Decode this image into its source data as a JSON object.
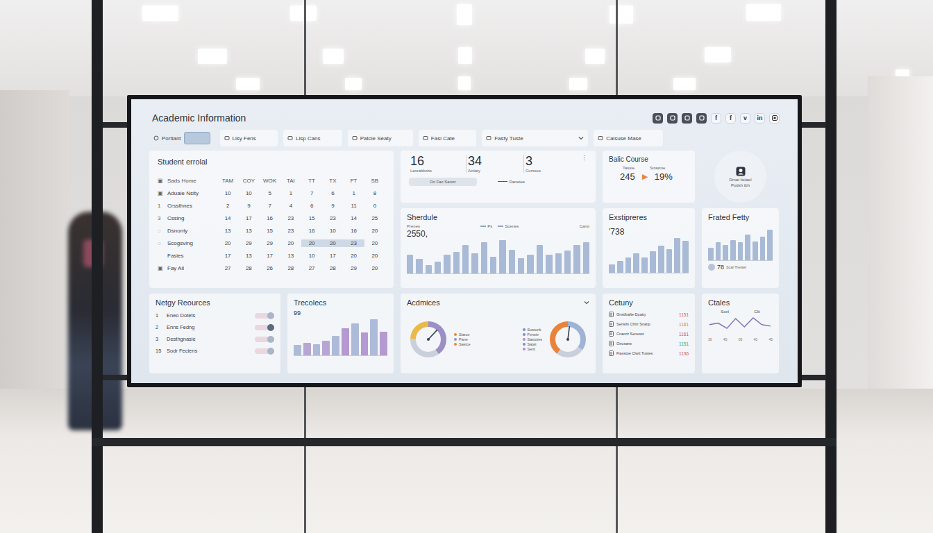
{
  "title": "Academic Information",
  "social": [
    "f",
    "f",
    "v",
    "in"
  ],
  "filters": [
    {
      "label": "Portiant",
      "kind": "radio",
      "selected": true
    },
    {
      "label": "Lisy Fens",
      "kind": "tab",
      "selected": false
    },
    {
      "label": "Lisp Cans",
      "kind": "tab",
      "selected": false
    },
    {
      "label": "Patcie Seaty",
      "kind": "tab",
      "selected": false
    },
    {
      "label": "Fasi Cate",
      "kind": "tab",
      "selected": false
    },
    {
      "label": "Fasty Tuste",
      "kind": "dropdown",
      "selected": false
    },
    {
      "label": "Calsuse Mase",
      "kind": "tab",
      "selected": false
    }
  ],
  "profile": {
    "name": "Dmat Itelael",
    "sub": "Podsh tbh"
  },
  "enrollment": {
    "title": "Student errolal",
    "header_mark": "▣",
    "header_label": "Sads Home",
    "columns": [
      "TAM",
      "COY",
      "WOK",
      "TAI",
      "TT",
      "TX",
      "FT",
      "SB"
    ],
    "rows": [
      {
        "mark": "▣",
        "label": "Aduaie Nsity",
        "cells": [
          "10",
          "10",
          "5",
          "1",
          "7",
          "6",
          "1",
          "8"
        ],
        "selected": [
          false,
          false,
          false,
          false,
          false,
          false,
          false,
          false
        ]
      },
      {
        "mark": "1",
        "label": "Crssthnes",
        "cells": [
          "2",
          "9",
          "7",
          "4",
          "6",
          "9",
          "11",
          "0"
        ],
        "selected": [
          false,
          false,
          false,
          false,
          false,
          false,
          false,
          false
        ]
      },
      {
        "mark": "3",
        "label": "Cssing",
        "cells": [
          "14",
          "17",
          "16",
          "23",
          "15",
          "23",
          "14",
          "25"
        ],
        "selected": [
          false,
          false,
          false,
          false,
          false,
          false,
          false,
          false
        ]
      },
      {
        "mark": "◌",
        "label": "Dsnonty",
        "cells": [
          "13",
          "13",
          "15",
          "23",
          "16",
          "10",
          "16",
          "20"
        ],
        "selected": [
          false,
          false,
          false,
          false,
          false,
          false,
          false,
          false
        ]
      },
      {
        "mark": "◌",
        "label": "Scogsving",
        "cells": [
          "20",
          "29",
          "29",
          "20",
          "20",
          "20",
          "23",
          "20"
        ],
        "selected": [
          false,
          false,
          false,
          false,
          true,
          true,
          true,
          false
        ]
      },
      {
        "mark": "",
        "label": "Fasies",
        "cells": [
          "17",
          "13",
          "17",
          "13",
          "10",
          "17",
          "20",
          "20"
        ],
        "selected": [
          false,
          false,
          false,
          false,
          false,
          false,
          false,
          false
        ]
      },
      {
        "mark": "▣",
        "label": "Fay Ail",
        "cells": [
          "27",
          "28",
          "26",
          "28",
          "27",
          "28",
          "29",
          "20"
        ],
        "selected": [
          false,
          false,
          false,
          false,
          false,
          false,
          false,
          false
        ]
      }
    ]
  },
  "stats": {
    "items": [
      {
        "value": "16",
        "label": "Lasrabbsbs"
      },
      {
        "value": "34",
        "label": "Actiaty"
      },
      {
        "value": "3",
        "label": "Cursses"
      }
    ],
    "more": "⋮",
    "pill": "On Fac Sarotr",
    "note": "Danetes"
  },
  "course": {
    "title": "Balic Course",
    "labels": [
      "Tassie",
      "Strastne"
    ],
    "value": "245",
    "arrow": "▶",
    "percent": "19%"
  },
  "schedule": {
    "title": "Sherdule",
    "left_label": "Prenes",
    "legend": [
      "Ps",
      "Scenes"
    ],
    "right_label": "Carst",
    "value": "2550,",
    "values": [
      40,
      30,
      18,
      25,
      40,
      45,
      60,
      42,
      65,
      35,
      70,
      50,
      32,
      40,
      60,
      40,
      42,
      48,
      60,
      66
    ]
  },
  "experiences": {
    "title": "Exstipreres",
    "value": "'738",
    "values": [
      20,
      28,
      35,
      45,
      35,
      50,
      62,
      55,
      80,
      74
    ]
  },
  "frated": {
    "title": "Frated Fetty",
    "values": [
      30,
      42,
      36,
      48,
      42,
      60,
      45,
      55,
      72
    ],
    "footer_value": "78",
    "footer_label": "Scal Trestel"
  },
  "resources": {
    "title": "Netgy Reources",
    "items": [
      {
        "num": "1",
        "label": "Eneo Dotets",
        "on": false
      },
      {
        "num": "2",
        "label": "Enns Fedng",
        "on": true
      },
      {
        "num": "3",
        "label": "Desthgnasie",
        "on": false
      },
      {
        "num": "15",
        "label": "Sodr Feciens",
        "on": false
      }
    ]
  },
  "trec": {
    "title": "Trecolecs",
    "value": "99",
    "bars": [
      {
        "value": 20,
        "color": "#aebbd8"
      },
      {
        "value": 24,
        "color": "#b7a6d3"
      },
      {
        "value": 22,
        "color": "#aebbd8"
      },
      {
        "value": 28,
        "color": "#b7a6d3"
      },
      {
        "value": 38,
        "color": "#aebbd8"
      },
      {
        "value": 52,
        "color": "#b49ad0"
      },
      {
        "value": 62,
        "color": "#aebbd8"
      },
      {
        "value": 44,
        "color": "#b49ad0"
      },
      {
        "value": 70,
        "color": "#aebbd8"
      },
      {
        "value": 46,
        "color": "#b49ad0"
      }
    ]
  },
  "academics": {
    "title": "Acdmices",
    "gauges": [
      {
        "kind": "legend-right",
        "level": 0.12,
        "segments": [
          {
            "value": 40,
            "color": "#9b8fc4"
          },
          {
            "value": 35,
            "color": "#c9d0dc"
          },
          {
            "value": 25,
            "color": "#e9b949"
          }
        ],
        "legend": [
          {
            "label": "Siarce",
            "color": "#e58a3a"
          },
          {
            "label": "Pane",
            "color": "#9b8fc4"
          },
          {
            "label": "Sasice",
            "color": "#e58a3a"
          }
        ]
      },
      {
        "kind": "legend-left",
        "level": 0.02,
        "segments": [
          {
            "value": 35,
            "color": "#9fb3d6"
          },
          {
            "value": 25,
            "color": "#c9d0dc"
          },
          {
            "value": 40,
            "color": "#e8833a"
          }
        ],
        "legend": [
          {
            "label": "Sustunk",
            "color": "#7b8bc6"
          },
          {
            "label": "Fensie",
            "color": "#7b8bc6"
          },
          {
            "label": "Sastotes",
            "color": "#b98ad0"
          },
          {
            "label": "Satat",
            "color": "#7b8bc6"
          },
          {
            "label": "Sent",
            "color": "#b98ad0"
          }
        ]
      }
    ]
  },
  "century": {
    "title": "Cetuny",
    "rows": [
      {
        "label": "Gnstlbafte Dpatty",
        "value": "1151",
        "color": "#d9534f"
      },
      {
        "label": "Sensifs Chtrr Snatip",
        "value": "1181",
        "color": "#e0873a"
      },
      {
        "label": "Cnaorir Senesst",
        "value": "1161",
        "color": "#d9534f"
      },
      {
        "label": "Oeusarw",
        "value": "1151",
        "color": "#3fa35a"
      },
      {
        "label": "Fiasstoe Clwtt Tustes",
        "value": "1136",
        "color": "#d9534f"
      }
    ]
  },
  "ctales": {
    "title": "Ctales",
    "labels": [
      "Scel",
      "Clit"
    ],
    "points": [
      3,
      3.4,
      2,
      4.6,
      2.4,
      4.8,
      3,
      2.6
    ],
    "ticks": [
      "30",
      "45",
      "05",
      "40",
      "45"
    ]
  }
}
